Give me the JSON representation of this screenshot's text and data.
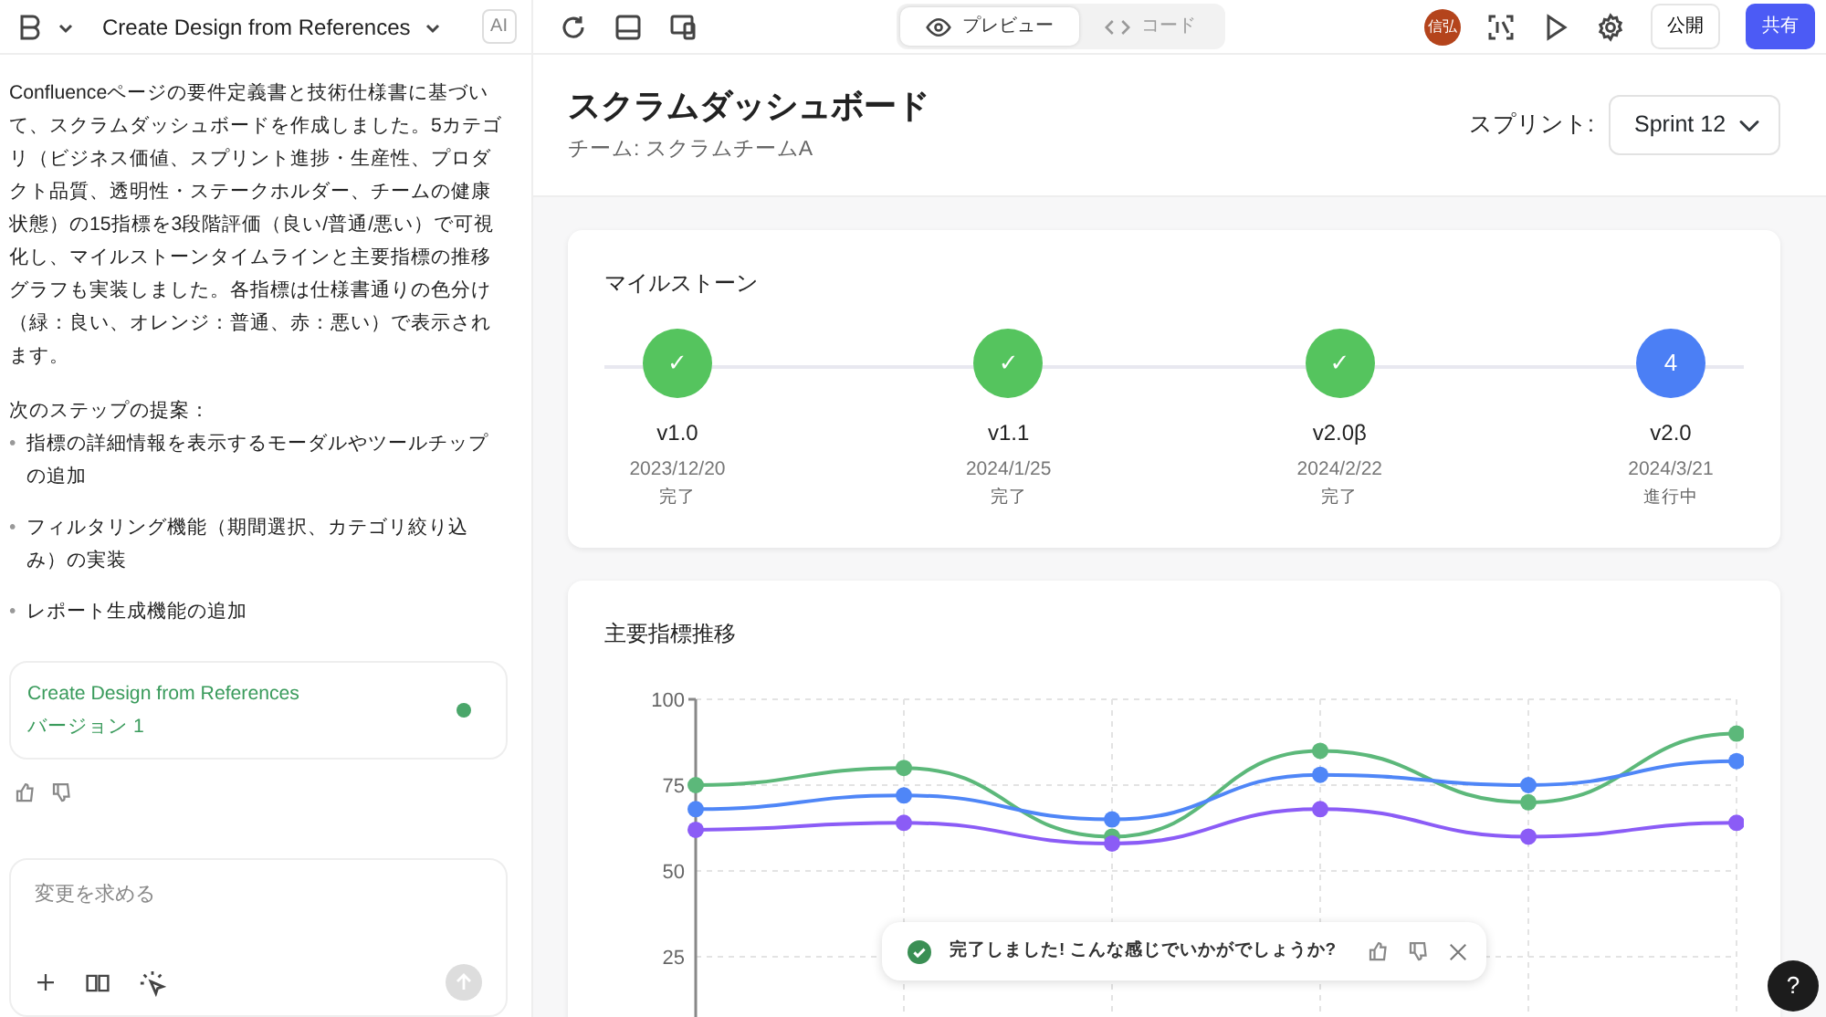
{
  "app": {
    "title": "Create Design from References",
    "ai_badge": "AI"
  },
  "message": {
    "text": "Confluenceページの要件定義書と技術仕様書に基づいて、スクラムダッシュボードを作成しました。5カテゴリ（ビジネス価値、スプリント進捗・生産性、プロダクト品質、透明性・ステークホルダー、チームの健康状態）の15指標を3段階評価（良い/普通/悪い）で可視化し、マイルストーンタイムラインと主要指標の推移グラフも実装しました。各指標は仕様書通りの色分け（緑：良い、オレンジ：普通、赤：悪い）で表示されます。",
    "next_steps_heading": "次のステップの提案：",
    "bullet": "•",
    "steps": [
      "指標の詳細情報を表示するモーダルやツールチップの追加",
      "フィルタリング機能（期間選択、カテゴリ絞り込み）の実装",
      "レポート生成機能の追加"
    ]
  },
  "version_card": {
    "title": "Create Design from References",
    "version": "バージョン 1"
  },
  "prompt": {
    "placeholder": "変更を求める"
  },
  "view_tabs": [
    {
      "label": "プレビュー",
      "selected": true,
      "kind": "preview"
    },
    {
      "label": "コード",
      "selected": false,
      "kind": "code"
    }
  ],
  "user_avatar": "信弘",
  "publish_button": "公開",
  "share_button": "共有",
  "dashboard": {
    "title": "スクラムダッシュボード",
    "subtitle": "チーム: スクラムチームA",
    "sprint_label": "スプリント:",
    "sprint_value": "Sprint 12"
  },
  "milestones": {
    "title": "マイルストーン",
    "items": [
      {
        "marker": "✓",
        "name": "v1.0",
        "date": "2023/12/20",
        "status": "完了",
        "kind": "done"
      },
      {
        "marker": "✓",
        "name": "v1.1",
        "date": "2024/1/25",
        "status": "完了",
        "kind": "done"
      },
      {
        "marker": "✓",
        "name": "v2.0β",
        "date": "2024/2/22",
        "status": "完了",
        "kind": "done"
      },
      {
        "marker": "4",
        "name": "v2.0",
        "date": "2024/3/21",
        "status": "進行中",
        "kind": "current"
      }
    ]
  },
  "trend": {
    "title": "主要指標推移",
    "chart_data": {
      "type": "line",
      "grid": true,
      "ylim": [
        0,
        100
      ],
      "yticks": [
        25,
        50,
        75,
        100
      ],
      "series": [
        {
          "color": "#5cb87a",
          "marker": "circle",
          "values": [
            75,
            80,
            60,
            85,
            70,
            90
          ]
        },
        {
          "color": "#4f86f7",
          "marker": "circle",
          "values": [
            68,
            72,
            65,
            78,
            75,
            82
          ]
        },
        {
          "color": "#8b5cf6",
          "marker": "circle",
          "values": [
            62,
            64,
            58,
            68,
            60,
            64
          ]
        }
      ]
    }
  },
  "toast": {
    "text": "完了しました! こんな感じでいかがでしょうか?"
  },
  "help": "?"
}
